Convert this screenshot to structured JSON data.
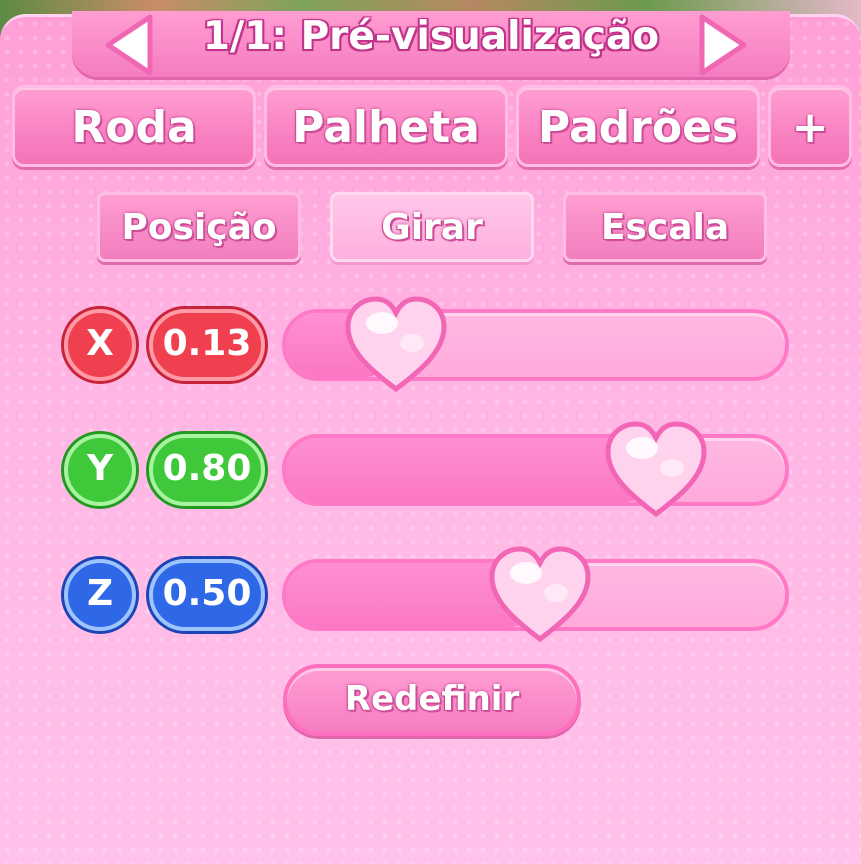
{
  "header": {
    "title": "1/1: Pré-visualização",
    "prev_icon": "arrow-left-icon",
    "next_icon": "arrow-right-icon"
  },
  "tabs": [
    {
      "label": "Roda"
    },
    {
      "label": "Palheta"
    },
    {
      "label": "Padrões"
    },
    {
      "label": "+"
    }
  ],
  "subtabs": {
    "selected": "Girar",
    "items": [
      {
        "label": "Posição"
      },
      {
        "label": "Girar"
      },
      {
        "label": "Escala"
      }
    ]
  },
  "sliders": [
    {
      "axis": "X",
      "value": "0.13",
      "fraction": 0.13,
      "color": "#f0404f"
    },
    {
      "axis": "Y",
      "value": "0.80",
      "fraction": 0.8,
      "color": "#3fc93a"
    },
    {
      "axis": "Z",
      "value": "0.50",
      "fraction": 0.5,
      "color": "#2e68e6"
    }
  ],
  "slider_thumb_icon": "heart-icon",
  "reset_button": {
    "label": "Redefinir"
  },
  "colors": {
    "accent": "#f57cbf",
    "panel": "#ffb6e4"
  }
}
